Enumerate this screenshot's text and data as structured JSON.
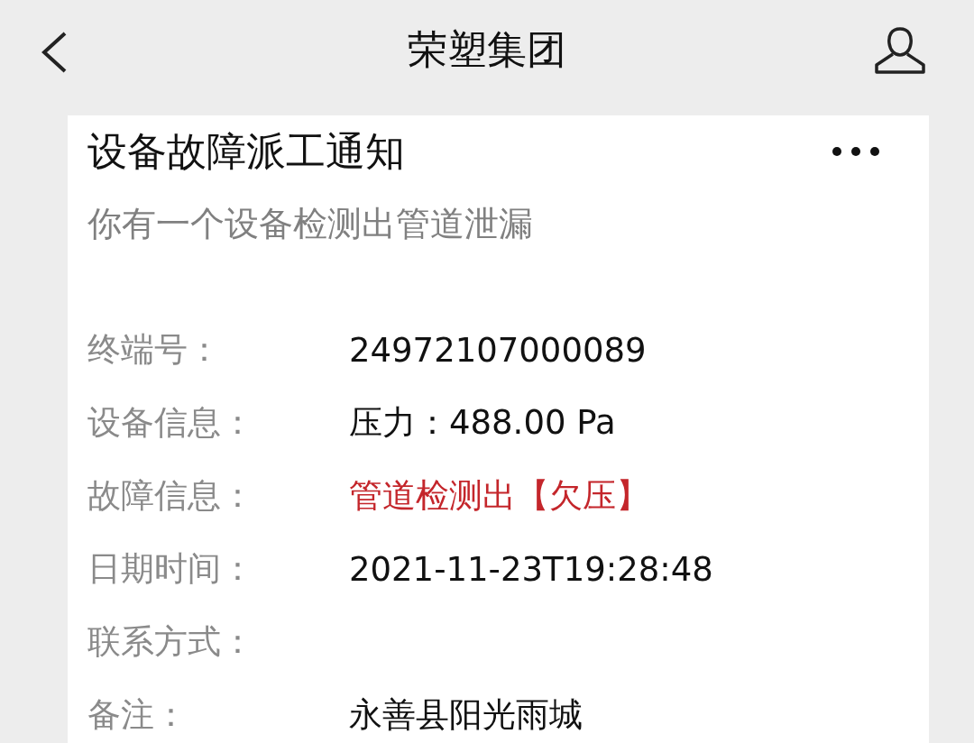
{
  "header": {
    "title": "荣塑集团"
  },
  "card": {
    "title": "设备故障派工通知",
    "subtitle": "你有一个设备检测出管道泄漏",
    "fields": [
      {
        "label": "终端号：",
        "value": "24972107000089",
        "alert": false
      },
      {
        "label": "设备信息：",
        "value": "压力：488.00 Pa",
        "alert": false
      },
      {
        "label": "故障信息：",
        "value": "管道检测出【欠压】",
        "alert": true
      },
      {
        "label": "日期时间：",
        "value": "2021-11-23T19:28:48",
        "alert": false
      },
      {
        "label": "联系方式："
      },
      {
        "label": "备注：",
        "value": "永善县阳光雨城",
        "alert": false
      }
    ]
  }
}
